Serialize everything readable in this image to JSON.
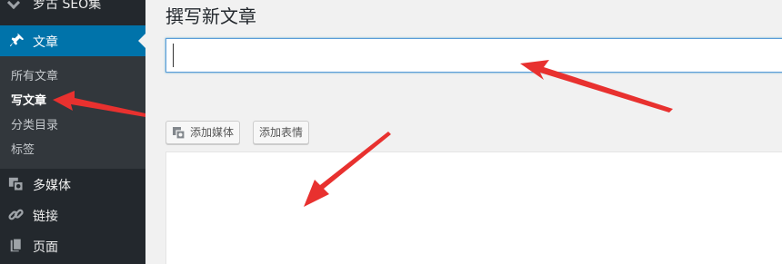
{
  "sidebar": {
    "site_label": "罗古 SEO集",
    "active_menu": "文章",
    "submenu": [
      "所有文章",
      "写文章",
      "分类目录",
      "标签"
    ],
    "current_submenu": "写文章",
    "items": [
      {
        "label": "多媒体",
        "icon": "media-icon"
      },
      {
        "label": "链接",
        "icon": "link-icon"
      },
      {
        "label": "页面",
        "icon": "page-icon"
      }
    ]
  },
  "main": {
    "page_title": "撰写新文章",
    "title_input_value": "",
    "add_media_label": "添加媒体",
    "add_emoji_label": "添加表情"
  },
  "colors": {
    "sidebar_bg": "#23282d",
    "submenu_bg": "#32373c",
    "active_bg": "#0073aa",
    "annotation_arrow": "#e8312f"
  }
}
